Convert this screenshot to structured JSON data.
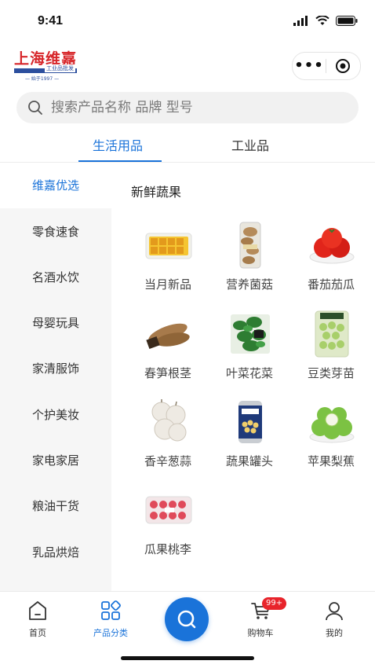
{
  "status_bar": {
    "time": "9:41"
  },
  "brand": {
    "name": "上海维嘉",
    "sub": "工业品批发",
    "year": "— 始于1997 —"
  },
  "search": {
    "placeholder": "搜索产品名称 品牌 型号"
  },
  "tabs": [
    {
      "label": "生活用品",
      "active": true
    },
    {
      "label": "工业品",
      "active": false
    }
  ],
  "sidebar": {
    "items": [
      {
        "label": "维嘉优选",
        "active": true
      },
      {
        "label": "零食速食",
        "active": false
      },
      {
        "label": "名酒水饮",
        "active": false
      },
      {
        "label": "母婴玩具",
        "active": false
      },
      {
        "label": "家清服饰",
        "active": false
      },
      {
        "label": "个护美妆",
        "active": false
      },
      {
        "label": "家电家居",
        "active": false
      },
      {
        "label": "粮油干货",
        "active": false
      },
      {
        "label": "乳品烘焙",
        "active": false
      }
    ]
  },
  "content": {
    "section_title": "新鲜蔬果",
    "products": [
      {
        "label": "当月新品",
        "icon": "yellow-tray-image"
      },
      {
        "label": "营养菌菇",
        "icon": "mushroom-pack-image"
      },
      {
        "label": "番茄茄瓜",
        "icon": "tomato-image"
      },
      {
        "label": "春笋根茎",
        "icon": "yam-image"
      },
      {
        "label": "叶菜花菜",
        "icon": "leafy-greens-image"
      },
      {
        "label": "豆类芽苗",
        "icon": "beans-bag-image"
      },
      {
        "label": "香辛葱蒜",
        "icon": "garlic-image"
      },
      {
        "label": "蔬果罐头",
        "icon": "canned-beans-image"
      },
      {
        "label": "苹果梨蕉",
        "icon": "green-apples-image"
      },
      {
        "label": "瓜果桃李",
        "icon": "berries-box-image"
      }
    ]
  },
  "tabbar": {
    "items": [
      {
        "label": "首页",
        "icon": "home-icon",
        "active": false
      },
      {
        "label": "产品分类",
        "icon": "category-icon",
        "active": true
      },
      {
        "label": "",
        "icon": "search-icon",
        "active": false
      },
      {
        "label": "购物车",
        "icon": "cart-icon",
        "active": false
      },
      {
        "label": "我的",
        "icon": "profile-icon",
        "active": false
      }
    ],
    "cart_badge": "99+"
  },
  "colors": {
    "accent": "#1a73d9",
    "brand_red": "#d7262a",
    "brand_blue": "#2c4f9e",
    "badge": "#e8242b"
  }
}
